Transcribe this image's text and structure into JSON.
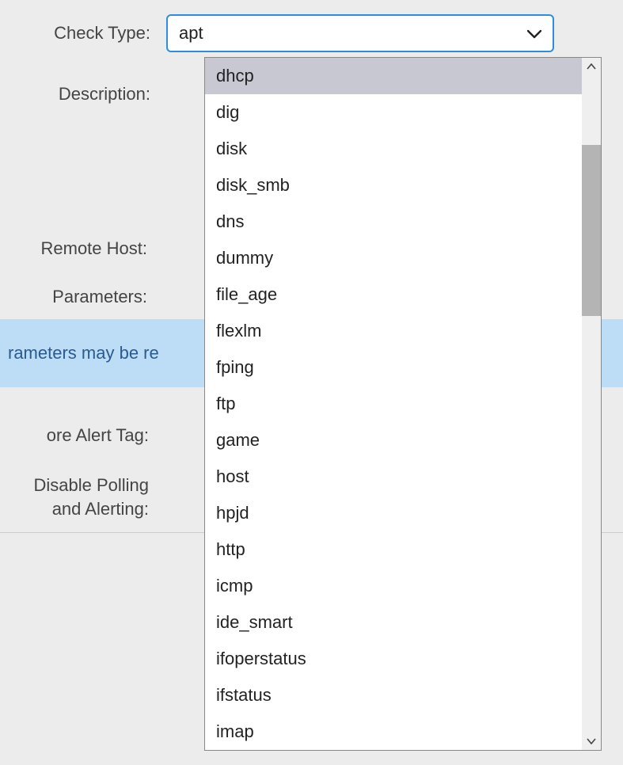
{
  "form": {
    "check_type_label": "Check Type:",
    "check_type_value": "apt",
    "description_label": "Description:",
    "remote_host_label": "Remote Host:",
    "parameters_label": "Parameters:",
    "banner_text": "rameters may be re",
    "ignore_alert_label": "ore Alert Tag:",
    "disable_polling_label_line1": "Disable Polling",
    "disable_polling_label_line2": "and Alerting:"
  },
  "dropdown": {
    "highlighted_index": 0,
    "options": [
      "dhcp",
      "dig",
      "disk",
      "disk_smb",
      "dns",
      "dummy",
      "file_age",
      "flexlm",
      "fping",
      "ftp",
      "game",
      "host",
      "hpjd",
      "http",
      "icmp",
      "ide_smart",
      "ifoperstatus",
      "ifstatus",
      "imap"
    ]
  }
}
